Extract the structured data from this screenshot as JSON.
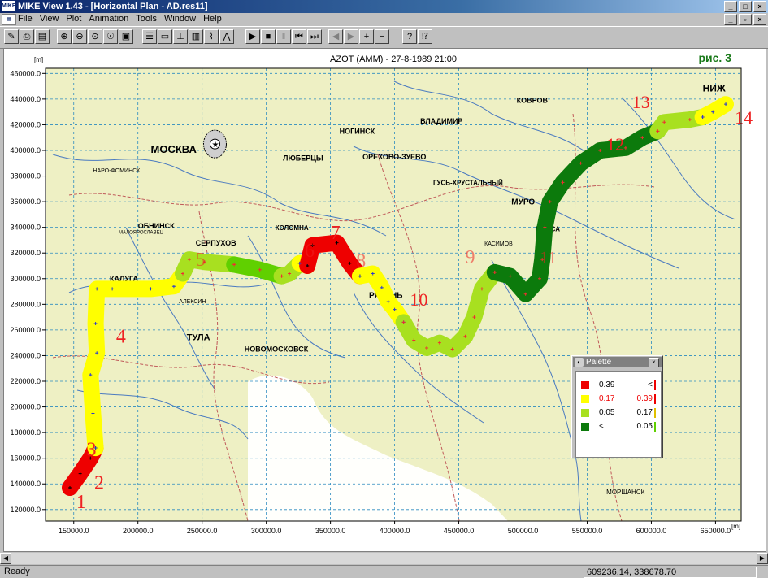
{
  "window": {
    "app_icon": "MIKE",
    "title": "MIKE View 1.43 - [Horizontal Plan - AD.res11]"
  },
  "menu": [
    "File",
    "View",
    "Plot",
    "Animation",
    "Tools",
    "Window",
    "Help"
  ],
  "toolbar": [
    {
      "name": "open-icon",
      "glyph": "✎"
    },
    {
      "name": "print-icon",
      "glyph": "⎙"
    },
    {
      "name": "print-setup-icon",
      "glyph": "▤"
    },
    {
      "name": "zoom-in-icon",
      "glyph": "⊕"
    },
    {
      "name": "zoom-out-icon",
      "glyph": "⊖"
    },
    {
      "name": "zoom-window-icon",
      "glyph": "⊙"
    },
    {
      "name": "pan-icon",
      "glyph": "☉"
    },
    {
      "name": "properties-icon",
      "glyph": "▣"
    },
    {
      "name": "layers-icon",
      "glyph": "☰"
    },
    {
      "name": "legend-icon",
      "glyph": "▭"
    },
    {
      "name": "profile-icon",
      "glyph": "⊥"
    },
    {
      "name": "histogram-icon",
      "glyph": "▥"
    },
    {
      "name": "time-series-icon",
      "glyph": "⌇"
    },
    {
      "name": "cross-section-icon",
      "glyph": "⋀"
    },
    {
      "name": "play-icon",
      "glyph": "▶"
    },
    {
      "name": "stop-icon",
      "glyph": "■"
    },
    {
      "name": "pause-icon",
      "glyph": "‖"
    },
    {
      "name": "rewind-icon",
      "glyph": "⏮"
    },
    {
      "name": "fast-forward-icon",
      "glyph": "⏭"
    },
    {
      "name": "step-back-icon",
      "glyph": "◀"
    },
    {
      "name": "step-forward-icon",
      "glyph": "▶"
    },
    {
      "name": "add-icon",
      "glyph": "+"
    },
    {
      "name": "remove-icon",
      "glyph": "−"
    },
    {
      "name": "help-icon",
      "glyph": "?"
    },
    {
      "name": "context-help-icon",
      "glyph": "⁉"
    }
  ],
  "plot": {
    "title": "АZОТ (АММ) - 27-8-1989 21:00",
    "figure_label": "рис. 3",
    "unit_label": "[m]",
    "y_ticks": [
      "460000.0",
      "440000.0",
      "420000.0",
      "400000.0",
      "380000.0",
      "360000.0",
      "340000.0",
      "320000.0",
      "300000.0",
      "280000.0",
      "260000.0",
      "240000.0",
      "220000.0",
      "200000.0",
      "180000.0",
      "160000.0",
      "140000.0",
      "120000.0"
    ],
    "x_ticks": [
      "150000.0",
      "200000.0",
      "250000.0",
      "300000.0",
      "350000.0",
      "400000.0",
      "450000.0",
      "500000.0",
      "550000.0",
      "600000.0",
      "650000.0"
    ],
    "route_segments": [
      {
        "color": "#ee0000",
        "points": [
          [
            147000,
            137000
          ],
          [
            155000,
            148000
          ],
          [
            163000,
            160000
          ],
          [
            167000,
            168000
          ]
        ]
      },
      {
        "color": "#ffff00",
        "points": [
          [
            167000,
            168000
          ],
          [
            165000,
            195000
          ],
          [
            163000,
            225000
          ],
          [
            168000,
            242000
          ],
          [
            167000,
            265000
          ],
          [
            168000,
            292000
          ],
          [
            180000,
            292000
          ],
          [
            210000,
            292000
          ],
          [
            228000,
            294000
          ],
          [
            235000,
            304000
          ]
        ]
      },
      {
        "color": "#a8e020",
        "points": [
          [
            235000,
            304000
          ],
          [
            240000,
            315000
          ],
          [
            252000,
            313000
          ],
          [
            275000,
            311000
          ]
        ]
      },
      {
        "color": "#60d000",
        "points": [
          [
            275000,
            311000
          ],
          [
            295000,
            307000
          ],
          [
            312000,
            302000
          ]
        ]
      },
      {
        "color": "#a8e020",
        "points": [
          [
            312000,
            302000
          ],
          [
            318000,
            304000
          ],
          [
            326000,
            312000
          ]
        ]
      },
      {
        "color": "#ffff00",
        "points": [
          [
            326000,
            312000
          ],
          [
            332000,
            310000
          ]
        ]
      },
      {
        "color": "#ee0000",
        "points": [
          [
            332000,
            310000
          ],
          [
            336000,
            326000
          ],
          [
            355000,
            328000
          ],
          [
            365000,
            312000
          ],
          [
            373000,
            302000
          ]
        ]
      },
      {
        "color": "#ffff00",
        "points": [
          [
            373000,
            302000
          ],
          [
            383000,
            304000
          ],
          [
            390000,
            293000
          ],
          [
            395000,
            282000
          ],
          [
            400000,
            276000
          ],
          [
            407000,
            266000
          ]
        ]
      },
      {
        "color": "#a8e020",
        "points": [
          [
            407000,
            266000
          ],
          [
            415000,
            252000
          ],
          [
            425000,
            246000
          ],
          [
            435000,
            250000
          ],
          [
            445000,
            245000
          ],
          [
            455000,
            255000
          ],
          [
            462000,
            270000
          ],
          [
            468000,
            292000
          ],
          [
            478000,
            305000
          ]
        ]
      },
      {
        "color": "#0c7a0c",
        "points": [
          [
            478000,
            305000
          ],
          [
            490000,
            302000
          ],
          [
            502000,
            288000
          ],
          [
            513000,
            300000
          ],
          [
            515000,
            315000
          ],
          [
            517000,
            340000
          ],
          [
            521000,
            360000
          ],
          [
            531000,
            375000
          ],
          [
            545000,
            390000
          ],
          [
            560000,
            400000
          ],
          [
            580000,
            402000
          ],
          [
            593000,
            410000
          ],
          [
            605000,
            415000
          ]
        ]
      },
      {
        "color": "#a8e020",
        "points": [
          [
            605000,
            415000
          ],
          [
            610000,
            422000
          ],
          [
            630000,
            424000
          ],
          [
            640000,
            426000
          ]
        ]
      },
      {
        "color": "#ffff00",
        "points": [
          [
            640000,
            426000
          ],
          [
            648000,
            430000
          ],
          [
            658000,
            436000
          ]
        ]
      }
    ],
    "point_labels": [
      "1",
      "2",
      "3",
      "4",
      "5",
      "6",
      "7",
      "8",
      "9",
      "10",
      "11",
      "12",
      "13",
      "14"
    ],
    "place_labels": [
      "МОСКВА",
      "ЛЮБЕРЦЫ",
      "ОРЕХОВО-ЗУЕВО",
      "НОГИНСК",
      "ВЛАДИМИР",
      "КОВРОВ",
      "НИЖ",
      "ГУСЬ-ХРУСТАЛЬНЫЙ",
      "МУРО",
      "ВЫКСА",
      "ОБНИНСК",
      "СЕРПУХОВ",
      "КОЛОМНА",
      "КАЛУГА",
      "ТУЛА",
      "НОВОМОСКОВСК",
      "РЯЗАНЬ",
      "МАЛОЯРОСЛАВЕЦ",
      "НАРО-ФОМИНСК",
      "МОРШАНСК",
      "КАСИМОВ",
      "АЛЕКСИН"
    ],
    "colors": {
      "red": "#ee0000",
      "yellow": "#ffff00",
      "light_green": "#a8e020",
      "green": "#60d000",
      "dark_green": "#0c7a0c",
      "label_red": "#ee2222",
      "figure_label": "#1a7a1a"
    }
  },
  "palette": {
    "title": "Palette",
    "rows": [
      {
        "color": "#ee0000",
        "lo": "0.39",
        "hi": "<",
        "bar": "#ee0000"
      },
      {
        "color": "#ffff00",
        "lo": "0.17",
        "hi": "0.39",
        "bar": "#ee0000"
      },
      {
        "color": "#a8e020",
        "lo": "0.05",
        "hi": "0.17",
        "bar": "#e0c000"
      },
      {
        "color": "#0c7a0c",
        "lo": "<",
        "hi": "0.05",
        "bar": "#60d000"
      }
    ]
  },
  "status": {
    "left": "Ready",
    "coords": "609236.14, 338678.70"
  }
}
